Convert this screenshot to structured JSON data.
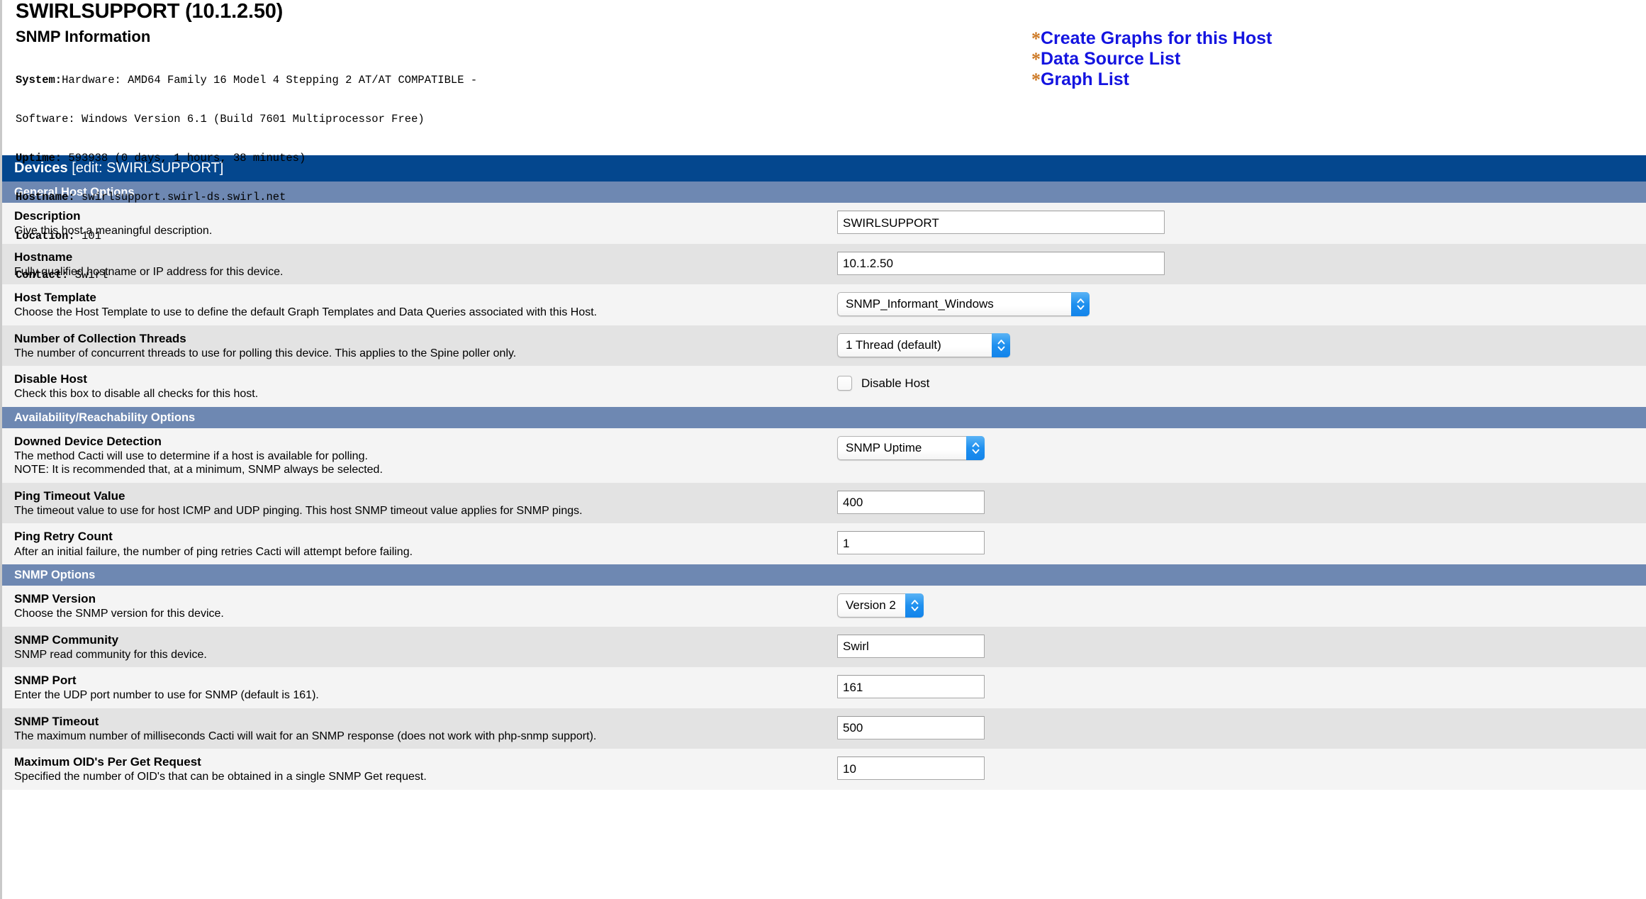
{
  "header": {
    "host_title": "SWIRLSUPPORT (10.1.2.50)",
    "snmp_heading": "SNMP Information",
    "snmp_info": [
      {
        "key": "System:",
        "value": "Hardware: AMD64 Family 16 Model 4 Stepping 2 AT/AT COMPATIBLE -"
      },
      {
        "key": "",
        "value": "Software: Windows Version 6.1 (Build 7601 Multiprocessor Free)"
      },
      {
        "key": "Uptime:",
        "value": " 593938 (0 days, 1 hours, 38 minutes)"
      },
      {
        "key": "Hostname:",
        "value": " swirlsupport.swirl-ds.swirl.net"
      },
      {
        "key": "Location:",
        "value": " 101"
      },
      {
        "key": "Contact:",
        "value": " Swirl"
      }
    ],
    "links": [
      {
        "bullet": "*",
        "label": "Create Graphs for this Host"
      },
      {
        "bullet": "*",
        "label": "Data Source List"
      },
      {
        "bullet": "*",
        "label": "Graph List"
      }
    ],
    "link_bullet_color": "#cc7722",
    "link_text_color": "#1414e0"
  },
  "titlebar": {
    "title": "Devices",
    "subtitle": "[edit: SWIRLSUPPORT]",
    "bg_color": "#04478e"
  },
  "sections": {
    "general": "General Host Options",
    "availability": "Availability/Reachability Options",
    "snmp": "SNMP Options",
    "bg_color": "#6e88b2"
  },
  "fields": {
    "description": {
      "label": "Description",
      "desc": "Give this host a meaningful description.",
      "value": "SWIRLSUPPORT"
    },
    "hostname": {
      "label": "Hostname",
      "desc": "Fully qualified hostname or IP address for this device.",
      "value": "10.1.2.50"
    },
    "host_template": {
      "label": "Host Template",
      "desc": "Choose the Host Template to use to define the default Graph Templates and Data Queries associated with this Host.",
      "value": "SNMP_Informant_Windows"
    },
    "collection_threads": {
      "label": "Number of Collection Threads",
      "desc": "The number of concurrent threads to use for polling this device. This applies to the Spine poller only.",
      "value": "1 Thread (default)"
    },
    "disable_host": {
      "label": "Disable Host",
      "desc": "Check this box to disable all checks for this host.",
      "checkbox_label": "Disable Host",
      "checked": false
    },
    "downed_device_detection": {
      "label": "Downed Device Detection",
      "desc": "The method Cacti will use to determine if a host is available for polling.",
      "note": "NOTE: It is recommended that, at a minimum, SNMP always be selected.",
      "value": "SNMP Uptime"
    },
    "ping_timeout": {
      "label": "Ping Timeout Value",
      "desc": "The timeout value to use for host ICMP and UDP pinging. This host SNMP timeout value applies for SNMP pings.",
      "value": "400"
    },
    "ping_retry": {
      "label": "Ping Retry Count",
      "desc": "After an initial failure, the number of ping retries Cacti will attempt before failing.",
      "value": "1"
    },
    "snmp_version": {
      "label": "SNMP Version",
      "desc": "Choose the SNMP version for this device.",
      "value": "Version 2"
    },
    "snmp_community": {
      "label": "SNMP Community",
      "desc": "SNMP read community for this device.",
      "value": "Swirl"
    },
    "snmp_port": {
      "label": "SNMP Port",
      "desc": "Enter the UDP port number to use for SNMP (default is 161).",
      "value": "161"
    },
    "snmp_timeout": {
      "label": "SNMP Timeout",
      "desc": "The maximum number of milliseconds Cacti will wait for an SNMP response (does not work with php-snmp support).",
      "value": "500"
    },
    "max_oids": {
      "label": "Maximum OID's Per Get Request",
      "desc": "Specified the number of OID's that can be obtained in a single SNMP Get request.",
      "value": "10"
    }
  }
}
